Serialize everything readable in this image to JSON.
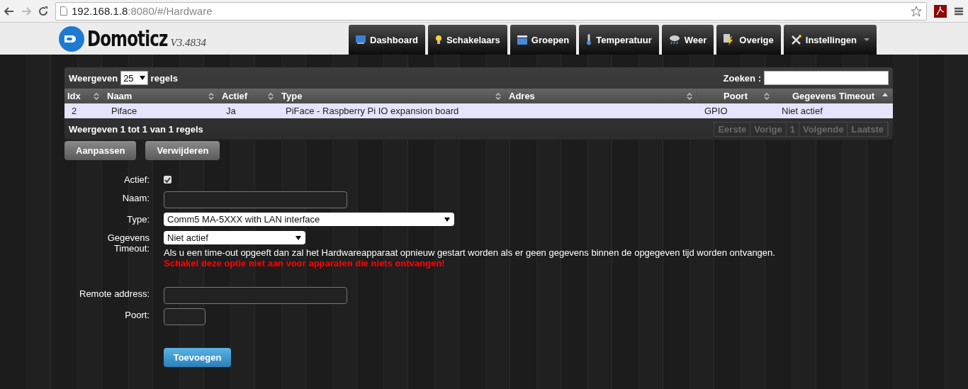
{
  "browser": {
    "url_host": "192.168.1.8",
    "url_path": ":8080/#/Hardware"
  },
  "header": {
    "logo": "Domoticz",
    "version": "V3.4834"
  },
  "nav": [
    {
      "label": "Dashboard",
      "dropdown": false
    },
    {
      "label": "Schakelaars",
      "dropdown": false
    },
    {
      "label": "Groepen",
      "dropdown": false
    },
    {
      "label": "Temperatuur",
      "dropdown": false
    },
    {
      "label": "Weer",
      "dropdown": false
    },
    {
      "label": "Overige",
      "dropdown": false
    },
    {
      "label": "Instellingen",
      "dropdown": true
    }
  ],
  "table": {
    "length_label": "Weergeven",
    "length_value": "25",
    "length_suffix": "regels",
    "search_label": "Zoeken :",
    "columns": [
      {
        "label": "Idx",
        "sorted": false
      },
      {
        "label": "Naam",
        "sorted": false
      },
      {
        "label": "Actief",
        "sorted": false
      },
      {
        "label": "Type",
        "sorted": false
      },
      {
        "label": "Adres",
        "sorted": false
      },
      {
        "label": "Poort",
        "sorted": false
      },
      {
        "label": "Gegevens Timeout",
        "sorted": true
      }
    ],
    "rows": [
      {
        "cells": [
          "2",
          "Piface",
          "Ja",
          "PiFace - Raspberry Pi IO expansion board",
          null,
          "GPIO",
          "Niet actief"
        ],
        "selected": true
      }
    ],
    "info": "Weergeven 1 tot 1 van 1 regels",
    "pagination": [
      {
        "label": "Eerste",
        "disabled": true
      },
      {
        "label": "Vorige",
        "disabled": true
      },
      {
        "label": "1",
        "disabled": true
      },
      {
        "label": "Volgende",
        "disabled": true
      },
      {
        "label": "Laatste",
        "disabled": true
      }
    ]
  },
  "actions": [
    "Aanpassen",
    "Verwijderen"
  ],
  "form": {
    "fields": [
      {
        "kind": "checkbox",
        "label": "Actief:",
        "checked": true
      },
      {
        "kind": "text",
        "label": "Naam:"
      },
      {
        "kind": "select",
        "label": "Type:",
        "value": "Comm5 MA-5XXX with LAN interface"
      },
      {
        "kind": "timeout",
        "label": "Gegevens Timeout:",
        "value": "Niet actief",
        "help": "Als u een time-out opgeeft dan zal het Hardwareapparaat opnieuw gestart worden als er geen gegevens binnen de opgegeven tijd worden ontvangen.",
        "warning": "Schakel deze optie niet aan voor apparaten die niets ontvangen!"
      },
      {
        "kind": "spacer"
      },
      {
        "kind": "text",
        "label": "Remote address:"
      },
      {
        "kind": "short_text",
        "label": "Poort:"
      }
    ],
    "submit": "Toevoegen"
  }
}
